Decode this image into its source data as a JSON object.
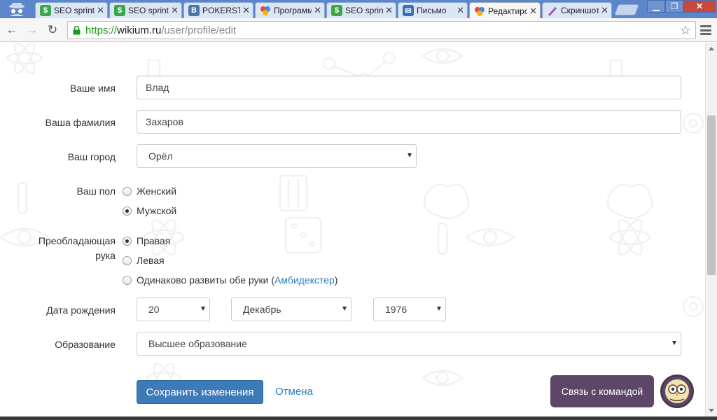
{
  "browser": {
    "tabs": [
      {
        "title": "",
        "favicon": "spy-icon"
      },
      {
        "title": "SEO sprint",
        "favicon": "dollar-s-icon",
        "favicon_color": "#3aa84a"
      },
      {
        "title": "SEO sprint",
        "favicon": "dollar-s-icon",
        "favicon_color": "#3aa84a"
      },
      {
        "title": "POKERSTRATEGY",
        "favicon": "vk-icon",
        "favicon_color": "#4a76a8"
      },
      {
        "title": "Программы",
        "favicon": "wikium-icon"
      },
      {
        "title": "SEO sprint",
        "favicon": "dollar-s-icon",
        "favicon_color": "#3aa84a"
      },
      {
        "title": "Письмо",
        "favicon": "mail-icon",
        "favicon_color": "#3b6fb5"
      },
      {
        "title": "Редактирование",
        "favicon": "wikium-icon",
        "active": true
      },
      {
        "title": "Скриншот",
        "favicon": "pen-icon"
      }
    ],
    "url": {
      "scheme": "https://",
      "host": "wikium.ru",
      "path": "/user/profile/edit"
    }
  },
  "form": {
    "first_name_label": "Ваше имя",
    "first_name_value": "Влад",
    "last_name_label": "Ваша фамилия",
    "last_name_value": "Захаров",
    "city_label": "Ваш город",
    "city_value": "Орёл",
    "gender_label": "Ваш пол",
    "gender_options": [
      "Женский",
      "Мужской"
    ],
    "gender_selected": "Мужской",
    "hand_label_line1": "Преобладающая",
    "hand_label_line2": "рука",
    "hand_options": [
      "Правая",
      "Левая"
    ],
    "hand_ambi_prefix": "Одинаково развиты обе руки (",
    "hand_ambi_link": "Амбидекстер",
    "hand_ambi_suffix": ")",
    "hand_selected": "Правая",
    "birth_label": "Дата рождения",
    "birth_day": "20",
    "birth_month": "Декабрь",
    "birth_year": "1976",
    "education_label": "Образование",
    "education_value": "Высшее образование",
    "save_label": "Сохранить изменения",
    "cancel_label": "Отмена"
  },
  "chat": {
    "label": "Связь с командой"
  },
  "colors": {
    "accent": "#3d7ab8",
    "link": "#2a7fbf",
    "chat": "#5d4768",
    "tabstrip": "#5b86c9"
  }
}
